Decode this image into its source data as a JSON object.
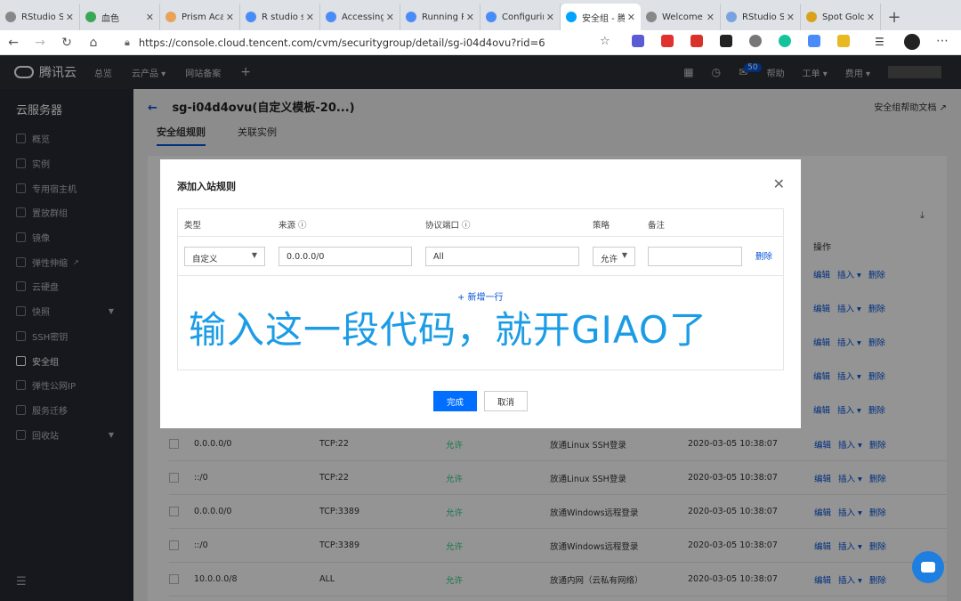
{
  "browser": {
    "tabs": [
      {
        "title": "RStudio Se",
        "color": "#888888"
      },
      {
        "title": "血色",
        "color": "#3aa757"
      },
      {
        "title": "Prism Aca",
        "color": "#e8a25c"
      },
      {
        "title": "R studio s",
        "color": "#4a8cf7"
      },
      {
        "title": "Accessing",
        "color": "#4a8cf7"
      },
      {
        "title": "Running R",
        "color": "#4a8cf7"
      },
      {
        "title": "Configurin",
        "color": "#4a8cf7"
      },
      {
        "title": "安全组 - 腾",
        "color": "#00a3ff",
        "active": true
      },
      {
        "title": "Welcome",
        "color": "#888888"
      },
      {
        "title": "RStudio Sh",
        "color": "#7aa2e0"
      },
      {
        "title": "Spot Gold",
        "color": "#d9a21b"
      }
    ],
    "url": "https://console.cloud.tencent.com/cvm/securitygroup/detail/sg-i04d4ovu?rid=6"
  },
  "topnav": {
    "brand": "腾讯云",
    "left": [
      "总览",
      "云产品 ▾",
      "网站备案",
      "+"
    ],
    "badge": "50",
    "right": [
      "帮助",
      "工单 ▾",
      "费用 ▾"
    ]
  },
  "sidebar": {
    "title": "云服务器",
    "items": [
      {
        "label": "概览",
        "icon": "grid-icon"
      },
      {
        "label": "实例",
        "icon": "cube-icon"
      },
      {
        "label": "专用宿主机",
        "icon": "host-icon"
      },
      {
        "label": "置放群组",
        "icon": "group-icon"
      },
      {
        "label": "镜像",
        "icon": "image-icon"
      },
      {
        "label": "弹性伸缩",
        "icon": "scale-icon"
      },
      {
        "label": "云硬盘",
        "icon": "disk-icon"
      },
      {
        "label": "快照",
        "icon": "camera-icon"
      },
      {
        "label": "SSH密钥",
        "icon": "key-icon"
      },
      {
        "label": "安全组",
        "icon": "shield-icon",
        "active": true
      },
      {
        "label": "弹性公网IP",
        "icon": "ip-icon"
      },
      {
        "label": "服务迁移",
        "icon": "migrate-icon"
      },
      {
        "label": "回收站",
        "icon": "trash-icon"
      }
    ]
  },
  "page": {
    "title": "sg-i04d4ovu(自定义模板-20...)",
    "help_doc": "安全组帮助文档",
    "tabs": [
      "安全组规则",
      "关联实例"
    ],
    "op_header": "操作",
    "row_actions": [
      "编辑",
      "插入 ▾",
      "删除"
    ],
    "rows": [
      {
        "source": "0.0.0.0/0",
        "port": "TCP:22",
        "policy": "允许",
        "note": "放通Linux SSH登录",
        "time": "2020-03-05 10:38:07"
      },
      {
        "source": "::/0",
        "port": "TCP:22",
        "policy": "允许",
        "note": "放通Linux SSH登录",
        "time": "2020-03-05 10:38:07"
      },
      {
        "source": "0.0.0.0/0",
        "port": "TCP:3389",
        "policy": "允许",
        "note": "放通Windows远程登录",
        "time": "2020-03-05 10:38:07"
      },
      {
        "source": "::/0",
        "port": "TCP:3389",
        "policy": "允许",
        "note": "放通Windows远程登录",
        "time": "2020-03-05 10:38:07"
      },
      {
        "source": "10.0.0.0/8",
        "port": "ALL",
        "policy": "允许",
        "note": "放通内网（云私有网络）",
        "time": "2020-03-05 10:38:07"
      }
    ]
  },
  "modal": {
    "title": "添加入站规则",
    "headers": {
      "type": "类型",
      "source": "来源 ⓘ",
      "port": "协议端口 ⓘ",
      "policy": "策略",
      "note": "备注"
    },
    "type_value": "自定义",
    "source_value": "0.0.0.0/0",
    "port_value": "All",
    "policy_value": "允许",
    "note_value": "",
    "delete_label": "删除",
    "add_row": "+ 新增一行",
    "overlay_text": "输入这一段代码，就开GIAO了",
    "ok": "完成",
    "cancel": "取消"
  }
}
